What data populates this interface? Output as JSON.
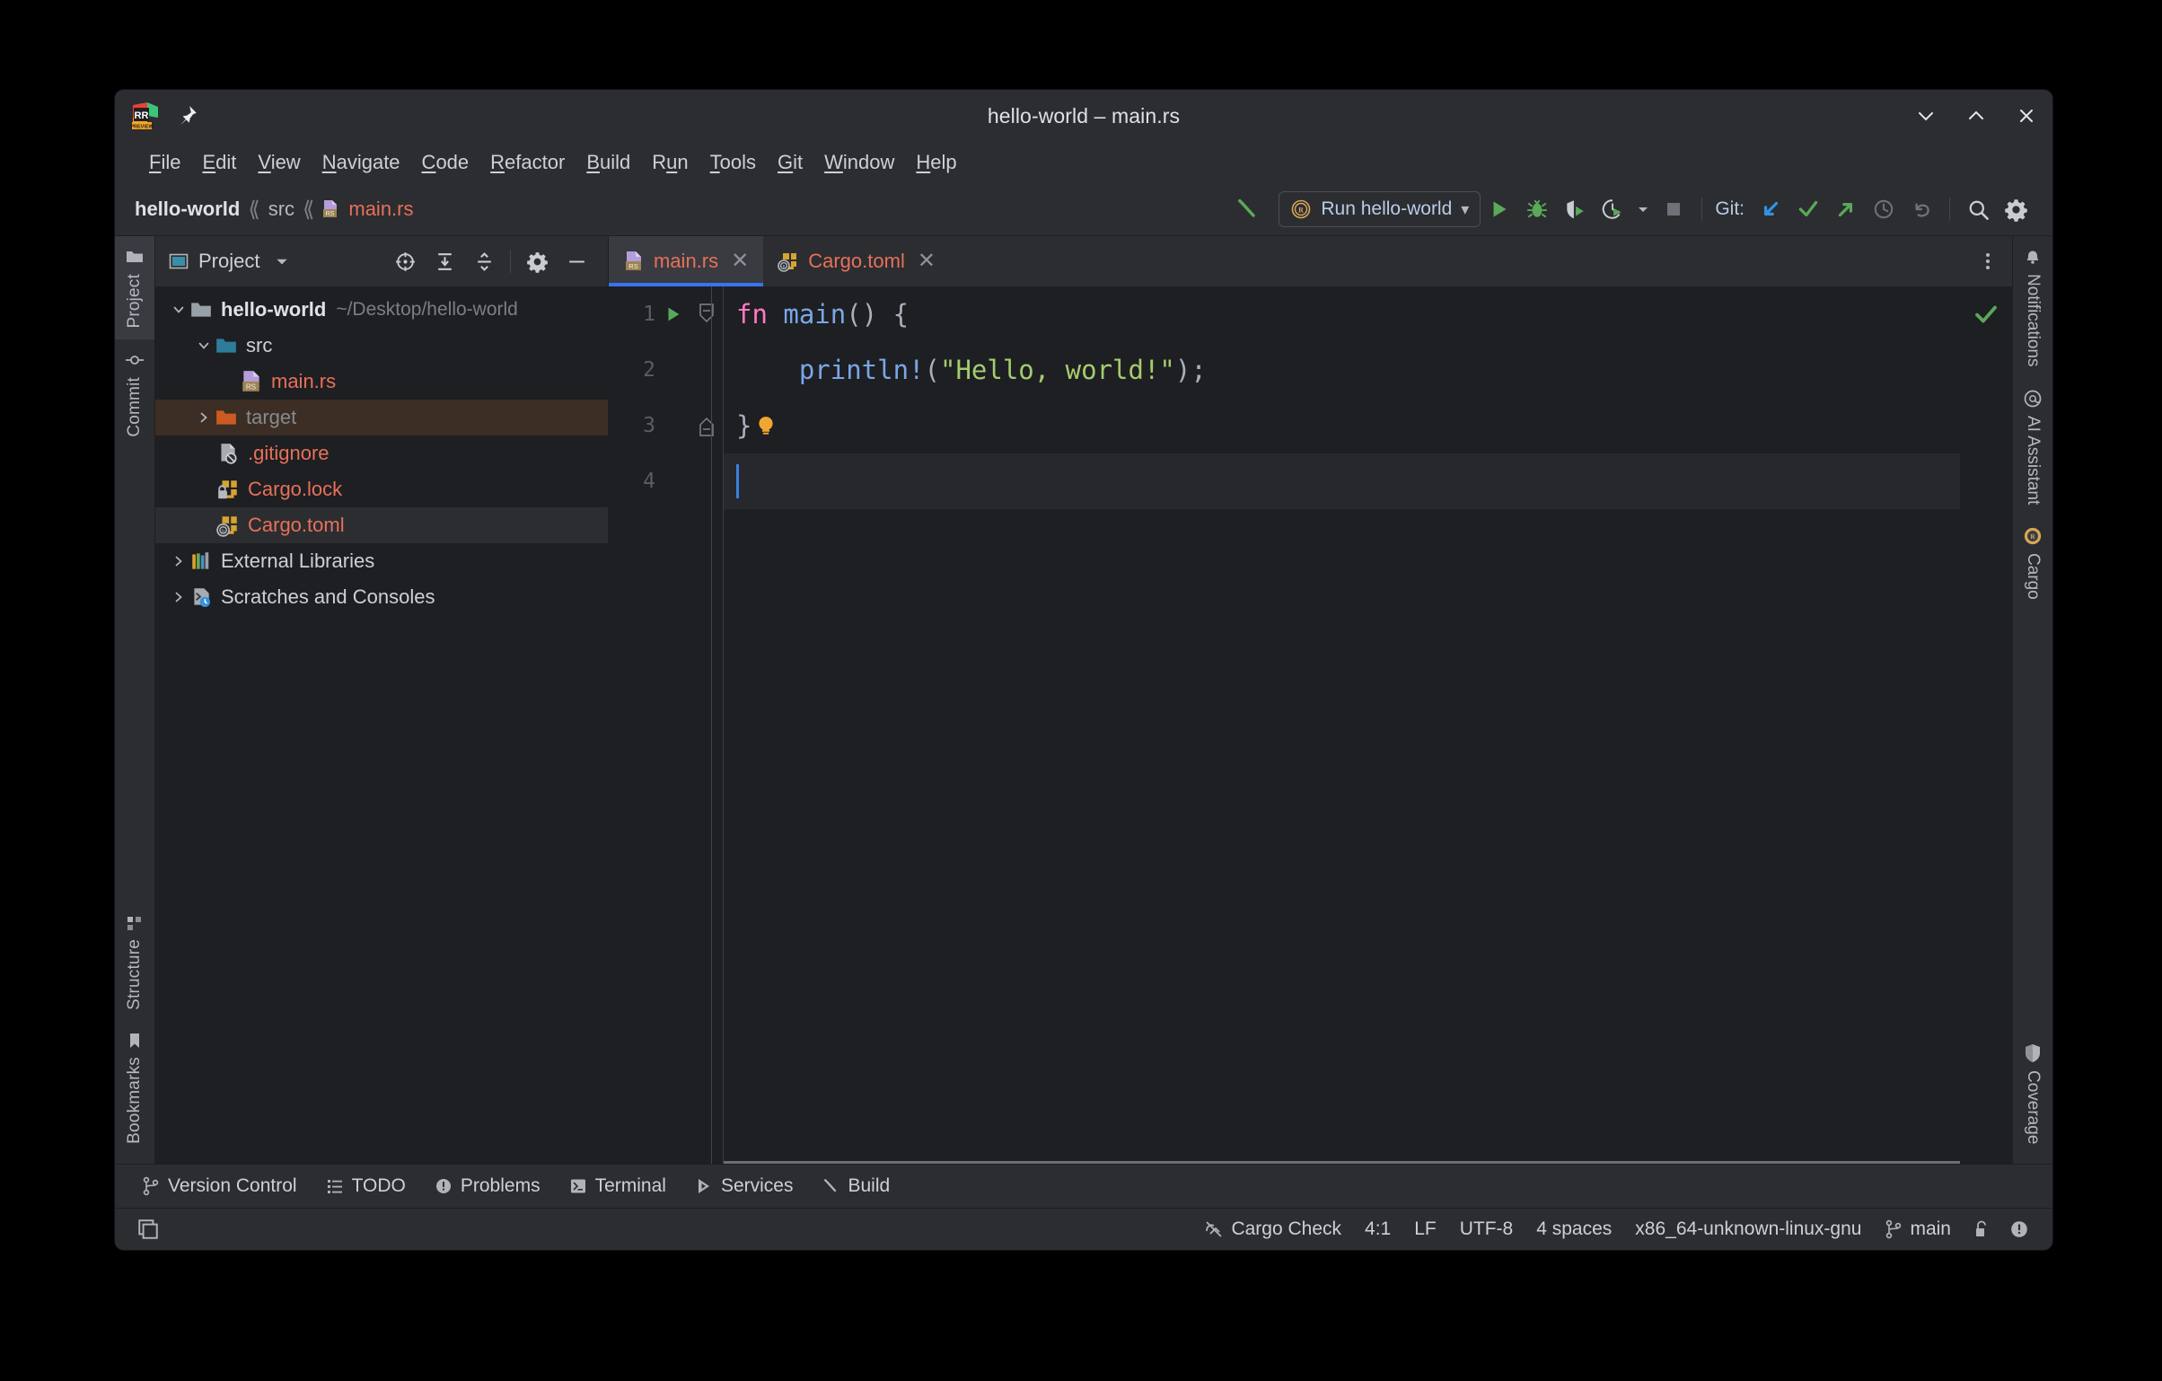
{
  "window": {
    "title": "hello-world – main.rs",
    "controls": {
      "minimize": "⌄",
      "maximize": "⌃",
      "close": "✕"
    },
    "app_logo_text": "RR",
    "app_logo_badge": "PREVIEW"
  },
  "menubar": {
    "items": [
      {
        "label": "File",
        "mnemonic": "F"
      },
      {
        "label": "Edit",
        "mnemonic": "E"
      },
      {
        "label": "View",
        "mnemonic": "V"
      },
      {
        "label": "Navigate",
        "mnemonic": "N"
      },
      {
        "label": "Code",
        "mnemonic": "C"
      },
      {
        "label": "Refactor",
        "mnemonic": "R"
      },
      {
        "label": "Build",
        "mnemonic": "B"
      },
      {
        "label": "Run",
        "mnemonic": "u"
      },
      {
        "label": "Tools",
        "mnemonic": "T"
      },
      {
        "label": "Git",
        "mnemonic": "G"
      },
      {
        "label": "Window",
        "mnemonic": "W"
      },
      {
        "label": "Help",
        "mnemonic": "H"
      }
    ]
  },
  "navbar": {
    "breadcrumbs": [
      {
        "label": "hello-world",
        "kind": "project"
      },
      {
        "label": "src",
        "kind": "folder"
      },
      {
        "label": "main.rs",
        "kind": "rust-file"
      }
    ],
    "separator": "〉",
    "build_icon": "hammer-icon",
    "run_config": {
      "label": "Run hello-world",
      "icon": "rust-logo-icon",
      "dropdown": "▾"
    },
    "actions": [
      {
        "name": "run-button",
        "glyph": "▶",
        "color": "#5aa85a"
      },
      {
        "name": "debug-button",
        "glyph": "bug",
        "color": "#5aa85a"
      },
      {
        "name": "run-with-coverage-button",
        "glyph": "coverage",
        "color": "#5aa85a"
      },
      {
        "name": "profiler-button",
        "glyph": "profile",
        "color": "#5aa85a"
      },
      {
        "name": "stop-button",
        "glyph": "■",
        "color": "#6e7178"
      }
    ],
    "git": {
      "label": "Git:",
      "update_project": "update-project-icon",
      "commit": "commit-icon",
      "push": "push-icon",
      "history": "history-icon",
      "rollback": "rollback-icon"
    },
    "search_icon": "search-icon",
    "settings_icon": "gear-icon"
  },
  "left_toolstrip": {
    "items": [
      {
        "label": "Project",
        "icon": "project-folder-icon",
        "active": true
      },
      {
        "label": "Commit",
        "icon": "commit-icon",
        "active": false
      }
    ],
    "bottom_items": [
      {
        "label": "Structure",
        "icon": "structure-icon"
      },
      {
        "label": "Bookmarks",
        "icon": "bookmark-icon"
      }
    ]
  },
  "right_toolstrip": {
    "items": [
      {
        "label": "Notifications",
        "icon": "bell-icon"
      },
      {
        "label": "AI Assistant",
        "icon": "ai-at-icon"
      },
      {
        "label": "Cargo",
        "icon": "rust-logo-icon"
      }
    ],
    "bottom_items": [
      {
        "label": "Coverage",
        "icon": "shield-icon"
      }
    ]
  },
  "project_panel": {
    "title": "Project",
    "dropdown": "▾",
    "actions": [
      {
        "name": "select-opened-file-icon",
        "title": "Select Opened File"
      },
      {
        "name": "expand-all-icon",
        "title": "Expand All"
      },
      {
        "name": "collapse-all-icon",
        "title": "Collapse All"
      },
      {
        "name": "gear-icon",
        "title": "Options"
      },
      {
        "name": "hide-icon",
        "title": "Hide"
      }
    ],
    "tree": [
      {
        "label": "hello-world",
        "suffix": "~/Desktop/hello-world",
        "depth": 0,
        "twisty": "expanded",
        "icon": "folder-module-icon",
        "style": "bold",
        "selected": "none"
      },
      {
        "label": "src",
        "suffix": "",
        "depth": 1,
        "twisty": "expanded",
        "icon": "folder-source-icon",
        "style": "normal",
        "selected": "none"
      },
      {
        "label": "main.rs",
        "suffix": "",
        "depth": 2,
        "twisty": "none",
        "icon": "rust-file-icon",
        "style": "rust",
        "selected": "none"
      },
      {
        "label": "target",
        "suffix": "",
        "depth": 1,
        "twisty": "collapsed",
        "icon": "folder-excluded-icon",
        "style": "dim",
        "selected": "target"
      },
      {
        "label": ".gitignore",
        "suffix": "",
        "depth": 2,
        "twisty": "none",
        "icon": "gitignore-icon",
        "style": "rust",
        "selected": "none"
      },
      {
        "label": "Cargo.lock",
        "suffix": "",
        "depth": 2,
        "twisty": "none",
        "icon": "cargo-lock-icon",
        "style": "rust",
        "selected": "none"
      },
      {
        "label": "Cargo.toml",
        "suffix": "",
        "depth": 2,
        "twisty": "none",
        "icon": "cargo-toml-icon",
        "style": "rust",
        "selected": "cargo"
      },
      {
        "label": "External Libraries",
        "suffix": "",
        "depth": 0,
        "twisty": "collapsed",
        "icon": "libraries-icon",
        "style": "normal",
        "selected": "none"
      },
      {
        "label": "Scratches and Consoles",
        "suffix": "",
        "depth": 0,
        "twisty": "collapsed",
        "icon": "scratches-icon",
        "style": "normal",
        "selected": "none"
      }
    ]
  },
  "editor": {
    "tabs": [
      {
        "label": "main.rs",
        "icon": "rust-file-icon",
        "active": true,
        "close": "✕"
      },
      {
        "label": "Cargo.toml",
        "icon": "cargo-toml-icon",
        "active": false,
        "close": "✕"
      }
    ],
    "more_options_icon": "⋮",
    "inspection_status": "check-ok-icon",
    "gutter_run_marker": "▶",
    "intention_bulb": "lightbulb-icon",
    "lines": [
      {
        "num": "1",
        "tokens": [
          {
            "t": "fn",
            "c": "kw2"
          },
          {
            "t": " ",
            "c": "punct"
          },
          {
            "t": "main",
            "c": "fnname"
          },
          {
            "t": "() {",
            "c": "punct"
          }
        ],
        "fold": "start",
        "run": true,
        "current": false
      },
      {
        "num": "2",
        "tokens": [
          {
            "t": "    ",
            "c": "punct"
          },
          {
            "t": "println!",
            "c": "macro"
          },
          {
            "t": "(",
            "c": "punct"
          },
          {
            "t": "\"Hello, world!\"",
            "c": "str"
          },
          {
            "t": ");",
            "c": "punct"
          }
        ],
        "fold": "none",
        "run": false,
        "current": false
      },
      {
        "num": "3",
        "tokens": [
          {
            "t": "}",
            "c": "punct"
          }
        ],
        "fold": "end",
        "run": false,
        "current": false,
        "bulb": true
      },
      {
        "num": "4",
        "tokens": [],
        "fold": "none",
        "run": false,
        "current": true,
        "caret": true
      }
    ]
  },
  "toolwindow_bar": {
    "items": [
      {
        "label": "Version Control",
        "icon": "branch-icon"
      },
      {
        "label": "TODO",
        "icon": "list-icon"
      },
      {
        "label": "Problems",
        "icon": "problems-icon"
      },
      {
        "label": "Terminal",
        "icon": "terminal-icon"
      },
      {
        "label": "Services",
        "icon": "services-icon"
      },
      {
        "label": "Build",
        "icon": "hammer-icon"
      }
    ]
  },
  "statusbar": {
    "left_icon": "layout-icon",
    "items": [
      {
        "label": "Cargo Check",
        "icon": "cargo-check-icon"
      },
      {
        "label": "4:1",
        "icon": ""
      },
      {
        "label": "LF",
        "icon": ""
      },
      {
        "label": "UTF-8",
        "icon": ""
      },
      {
        "label": "4 spaces",
        "icon": ""
      },
      {
        "label": "x86_64-unknown-linux-gnu",
        "icon": ""
      },
      {
        "label": "main",
        "icon": "branch-icon"
      }
    ],
    "trailing_icons": [
      {
        "name": "unlock-icon"
      },
      {
        "name": "problems-icon"
      }
    ]
  },
  "colors": {
    "accent_blue": "#3574f0",
    "rust_orange": "#e8705a",
    "green": "#5aa85a",
    "string_green": "#a5cc6e",
    "keyword_pink": "#ff79c6",
    "panel_bg": "#2b2d30",
    "editor_bg": "#1e1f22"
  }
}
